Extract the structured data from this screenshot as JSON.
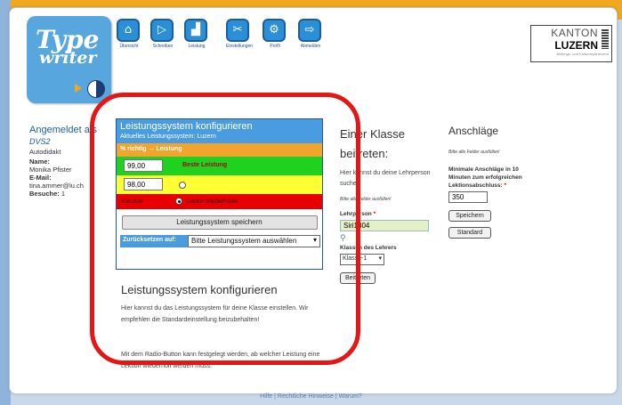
{
  "logo": {
    "line1": "Type",
    "line2": "writer"
  },
  "nav": [
    {
      "icon": "⌂",
      "label": "Übersicht",
      "name": "nav-overview"
    },
    {
      "icon": "▷",
      "label": "Schreiben",
      "name": "nav-write"
    },
    {
      "icon": "▟",
      "label": "Leistung",
      "name": "nav-performance"
    },
    {
      "icon": "✂",
      "label": "Einstellungen",
      "name": "nav-settings"
    },
    {
      "icon": "⚙",
      "label": "Profil",
      "name": "nav-profile"
    },
    {
      "icon": "⇨",
      "label": "Abmelden",
      "name": "nav-logout"
    }
  ],
  "kanton": {
    "line1": "KANTON",
    "line2": "LUZERN",
    "line3": "Bildungs- und Kulturdepartement"
  },
  "user": {
    "heading": "Angemeldet als",
    "username": "DVS2",
    "type": "Autodidakt",
    "name_label": "Name:",
    "name": "Monika Pfister",
    "email_label": "E-Mail:",
    "email": "tina.ammer@lu.ch",
    "visits_label": "Besuche:",
    "visits": "1"
  },
  "panel": {
    "title": "Leistungssystem konfigurieren",
    "current": "Aktuelles Leistungssystem: Luzern",
    "header_row": "% richtig  →  Leistung",
    "green_value": "99,00",
    "green_label": "Beste Leistung",
    "yellow_value": "98,00",
    "red_label1": "darunter",
    "red_label2": "Lektion wiederholen",
    "save_label": "Leistungssystem speichern",
    "reset_label": "Zurücksetzen auf:",
    "reset_select": "Bitte Leistungssystem auswählen"
  },
  "main": {
    "heading": "Leistungssystem konfigurieren",
    "para1": "Hier kannst du das Leistungssystem für deine Klasse einstellen. Wir empfehlen die Standardeinstellung beizubehalten!",
    "para2": "Mit dem Radio-Button kann festgelegt werden, ab welcher Leistung eine Lektion wiederholt werden muss."
  },
  "class": {
    "heading1": "Einer Klasse",
    "heading2": "beitreten:",
    "text": "Hier kannst du deine Lehrperson suchen",
    "note": "Bitte alle Felder ausfüllen!",
    "teacher_label": "Lehrperson",
    "teacher_value": "Siri1304",
    "classes_label": "Klassen des Lehrers",
    "classes_select": "Klasse-1",
    "join_label": "Beitreten"
  },
  "strokes": {
    "heading": "Anschläge",
    "note": "Bitte alle Felder ausfüllen!",
    "min_label": "Minimale Anschläge in 10 Minuten zum erfolgreichen Lektionsabschluss:",
    "min_value": "350",
    "save_label": "Speichern",
    "default_label": "Standard"
  },
  "footer": "Hilfe | Rechtliche Hinweise | Warum?",
  "colors": {
    "annotation": "#e51616",
    "orange": "#f0a81e",
    "panel_blue": "#4a9ce0"
  }
}
